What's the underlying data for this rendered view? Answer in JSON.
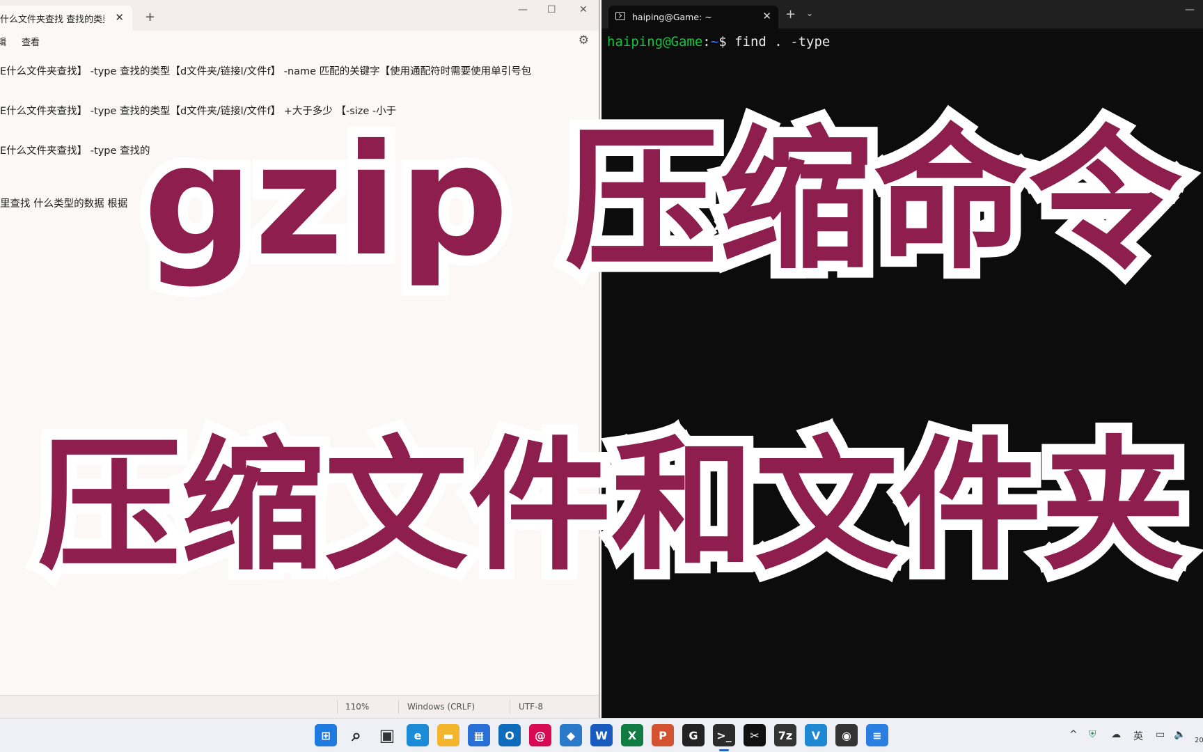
{
  "notepad": {
    "tab_title": "什么文件夹查找 查找的类型",
    "tab_close": "✕",
    "new_tab": "+",
    "minimize": "—",
    "maximize": "☐",
    "close": "✕",
    "menu": [
      "辑",
      "查看"
    ],
    "settings_icon": "gear-icon",
    "lines": [
      "E什么文件夹查找】 -type 查找的类型【d文件夹/链接l/文件f】 -name 匹配的关键字【使用通配符时需要使用单引号包",
      "E什么文件夹查找】 -type 查找的类型【d文件夹/链接l/文件f】        +大于多少 【-size -小于",
      "E什么文件夹查找】 -type 查找的",
      "里查找 什么类型的数据 根据"
    ],
    "status": {
      "zoom": "110%",
      "line_ending": "Windows (CRLF)",
      "encoding": "UTF-8"
    }
  },
  "terminal": {
    "tab_title": "haiping@Game: ~",
    "tab_close": "✕",
    "new_tab": "+",
    "dropdown": "⌄",
    "minimize": "—",
    "prompt_user": "haiping@Game",
    "prompt_sep": ":",
    "prompt_path": "~",
    "prompt_dollar": "$ ",
    "command": "find . -type"
  },
  "overlay": {
    "line1": "gzip 压缩命令",
    "line2": "压缩文件和文件夹",
    "color": "#8d1e4d"
  },
  "taskbar": {
    "icons": [
      {
        "name": "start-icon",
        "label": "⊞",
        "color": "#1f7ae0"
      },
      {
        "name": "search-icon",
        "label": "⌕",
        "color": "#222222"
      },
      {
        "name": "task-view-icon",
        "label": "▣",
        "color": "#333333"
      },
      {
        "name": "edge-icon",
        "label": "e",
        "color": "#1b8bd6"
      },
      {
        "name": "file-explorer-icon",
        "label": "▬",
        "color": "#f2b52c"
      },
      {
        "name": "store-icon",
        "label": "▦",
        "color": "#2a6fd6"
      },
      {
        "name": "outlook-icon",
        "label": "O",
        "color": "#0f6cbd"
      },
      {
        "name": "debian-icon",
        "label": "@",
        "color": "#d70a53"
      },
      {
        "name": "box-icon",
        "label": "◆",
        "color": "#2b7ac9"
      },
      {
        "name": "word-icon",
        "label": "W",
        "color": "#185abd"
      },
      {
        "name": "excel-icon",
        "label": "X",
        "color": "#107c41"
      },
      {
        "name": "powerpoint-icon",
        "label": "P",
        "color": "#d35230"
      },
      {
        "name": "grammarly-icon",
        "label": "G",
        "color": "#222222"
      },
      {
        "name": "terminal-icon",
        "label": ">_",
        "color": "#2b2b2b"
      },
      {
        "name": "capcut-icon",
        "label": "✂",
        "color": "#111111"
      },
      {
        "name": "7zip-icon",
        "label": "7z",
        "color": "#333333"
      },
      {
        "name": "v-app-icon",
        "label": "V",
        "color": "#1e88d2"
      },
      {
        "name": "camera-app-icon",
        "label": "◉",
        "color": "#333333"
      },
      {
        "name": "notepad-icon",
        "label": "≡",
        "color": "#2a7de1"
      }
    ],
    "tray": {
      "chevron": "^",
      "ime": "英",
      "clock_fragment": "20"
    }
  }
}
